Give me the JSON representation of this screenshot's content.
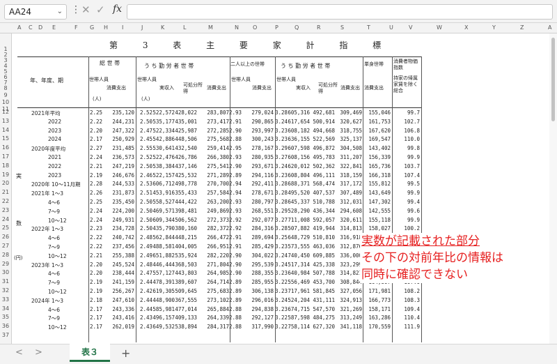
{
  "formula_bar": {
    "name_box": "AA24",
    "fx": "fx",
    "value": ""
  },
  "columns": [
    "A",
    "C",
    "D",
    "E",
    "F",
    "G",
    "H",
    "I",
    "J",
    "K",
    "L",
    "M",
    "N",
    "O",
    "P",
    "Q",
    "R",
    "S",
    "T",
    "U",
    "V",
    "W",
    "X",
    "Y",
    "Z",
    "A"
  ],
  "rows_top": [
    "1",
    "2",
    "3",
    "4",
    "5",
    "6",
    "7",
    "8",
    "9",
    "10",
    "11"
  ],
  "table": {
    "title": "第 3 表 主 要 家 計 指 標",
    "header_period": "年、年度、期",
    "group_total": "総 世 帯",
    "group_worker": "う ち 勤 労 者 世 帯",
    "group_two": "二人以上の世帯",
    "group_two_worker": "う ち 勤 労 者 世 帯",
    "group_single": "単身世帯",
    "group_cpi": "消費者物価指数",
    "h_persons": "世帯人員",
    "h_unit": "(人)",
    "h_consumption": "消費支出",
    "h_income": "実収入",
    "h_disposable": "可処分所得",
    "h_cpi_note": "持家の帰属家賃を除く総合",
    "side_jitsu": "実",
    "side_su": "数",
    "side_yen": "(円)"
  },
  "data_rows": [
    {
      "row": "12",
      "label": "2021年平均",
      "v": [
        "2.25",
        "235,120",
        "2.52",
        "522,572",
        "428,022",
        "283,807",
        "2.93",
        "279,024",
        "3.28",
        "605,316",
        "492,681",
        "309,469",
        "155,046",
        "99.7"
      ]
    },
    {
      "row": "13",
      "label": "2022",
      "v": [
        "2.22",
        "244,231",
        "2.50",
        "535,177",
        "435,001",
        "273,417",
        "2.91",
        "290,865",
        "3.24",
        "617,654",
        "500,914",
        "320,627",
        "161,753",
        "102.7"
      ]
    },
    {
      "row": "14",
      "label": "2023",
      "v": [
        "2.20",
        "247,322",
        "2.47",
        "522,334",
        "425,987",
        "272,285",
        "2.90",
        "293,997",
        "3.23",
        "608,182",
        "494,668",
        "318,755",
        "167,620",
        "106.8"
      ]
    },
    {
      "row": "15",
      "label": "2024",
      "v": [
        "2.17",
        "250,929",
        "2.45",
        "542,886",
        "448,506",
        "275,568",
        "2.88",
        "300,243",
        "3.23",
        "636,155",
        "522,569",
        "325,137",
        "169,547",
        "110.0"
      ]
    },
    {
      "row": "16",
      "label": "2020年度平均",
      "v": [
        "2.27",
        "231,485",
        "2.55",
        "530,641",
        "432,540",
        "259,414",
        "2.95",
        "278,167",
        "3.29",
        "607,598",
        "496,872",
        "304,508",
        "143,402",
        "99.8"
      ]
    },
    {
      "row": "17",
      "label": "2021",
      "v": [
        "2.24",
        "236,573",
        "2.52",
        "522,476",
        "426,786",
        "266,380",
        "2.93",
        "280,935",
        "3.27",
        "608,156",
        "495,783",
        "311,207",
        "156,339",
        "99.9"
      ]
    },
    {
      "row": "18",
      "label": "2022",
      "v": [
        "2.21",
        "247,219",
        "2.50",
        "538,384",
        "437,146",
        "275,541",
        "2.90",
        "293,671",
        "3.24",
        "620,012",
        "502,362",
        "322,841",
        "165,736",
        "103.7"
      ]
    },
    {
      "row": "19",
      "label": "2023",
      "v": [
        "2.19",
        "246,676",
        "2.46",
        "522,157",
        "425,532",
        "271,289",
        "2.89",
        "294,116",
        "3.23",
        "608,804",
        "496,111",
        "318,159",
        "166,318",
        "107.4"
      ]
    },
    {
      "row": "20",
      "label": "2020年 10～11月期",
      "v": [
        "2.28",
        "244,533",
        "2.53",
        "606,712",
        "498,778",
        "270,700",
        "2.94",
        "292,411",
        "3.28",
        "688,371",
        "568,474",
        "317,172",
        "155,812",
        "99.5"
      ]
    },
    {
      "row": "21",
      "label": "2021年 1～3",
      "v": [
        "2.26",
        "231,873",
        "2.51",
        "453,916",
        "355,433",
        "257,584",
        "2.94",
        "278,671",
        "3.28",
        "495,520",
        "407,537",
        "307,489",
        "143,649",
        "99.9"
      ]
    },
    {
      "row": "22",
      "label": "4～6",
      "v": [
        "2.25",
        "235,450",
        "2.50",
        "558,527",
        "444,422",
        "263,200",
        "2.93",
        "280,797",
        "3.28",
        "645,337",
        "510,788",
        "312,031",
        "147,302",
        "99.4"
      ]
    },
    {
      "row": "23",
      "label": "7～9",
      "v": [
        "2.24",
        "224,200",
        "2.50",
        "469,571",
        "398,481",
        "249,869",
        "2.93",
        "268,551",
        "3.29",
        "528,290",
        "436,344",
        "294,608",
        "142,555",
        "99.6"
      ]
    },
    {
      "row": "24",
      "label": "10～12",
      "v": [
        "2.24",
        "249,931",
        "2.50",
        "609,344",
        "506,562",
        "272,373",
        "2.92",
        "292,077",
        "3.27",
        "711,008",
        "592,057",
        "320,611",
        "155,118",
        "99.9"
      ]
    },
    {
      "row": "25",
      "label": "2022年 1～3",
      "v": [
        "2.23",
        "234,728",
        "2.50",
        "435,790",
        "380,160",
        "282,372",
        "2.92",
        "284,316",
        "3.28",
        "507,882",
        "419,944",
        "314,813",
        "158,027",
        "100.2"
      ]
    },
    {
      "row": "26",
      "label": "4～6",
      "v": [
        "2.22",
        "240,742",
        "2.48",
        "562,844",
        "448,215",
        "266,472",
        "2.91",
        "289,694",
        "3.25",
        "648,729",
        "510,810",
        "316,918",
        "157,120",
        "101.8"
      ]
    },
    {
      "row": "27",
      "label": "7～9",
      "v": [
        "2.22",
        "237,456",
        "2.49",
        "488,581",
        "404,005",
        "266,951",
        "2.91",
        "285,429",
        "3.23",
        "573,555",
        "463,036",
        "312,876",
        "155,806",
        "102.9"
      ]
    },
    {
      "row": "28",
      "label": "10～12",
      "v": [
        "2.21",
        "255,388",
        "2.49",
        "651,882",
        "535,924",
        "282,220",
        "2.90",
        "304,022",
        "3.24",
        "740,450",
        "609,885",
        "336,000",
        "168,094",
        "104.6"
      ]
    },
    {
      "row": "29",
      "label": "2023年 1～3",
      "v": [
        "2.20",
        "245,524",
        "2.48",
        "446,444",
        "368,503",
        "271,804",
        "2.90",
        "295,539",
        "3.24",
        "517,314",
        "425,338",
        "323,299",
        "159,241",
        "105.1"
      ]
    },
    {
      "row": "30",
      "label": "4～6",
      "v": [
        "2.20",
        "238,444",
        "2.47",
        "557,127",
        "443,803",
        "264,985",
        "2.90",
        "288,355",
        "3.23",
        "640,984",
        "507,788",
        "314,821",
        "153,027",
        "106.0"
      ]
    },
    {
      "row": "31",
      "label": "7～9",
      "v": [
        "2.19",
        "241,159",
        "2.44",
        "478,391",
        "389,607",
        "264,714",
        "2.89",
        "285,955",
        "3.22",
        "556,469",
        "453,700",
        "308,844",
        "164,807",
        "107.0"
      ]
    },
    {
      "row": "32",
      "label": "10～12",
      "v": [
        "2.19",
        "256,267",
        "2.42",
        "619,305",
        "509,645",
        "275,683",
        "2.89",
        "306,138",
        "3.23",
        "717,961",
        "581,845",
        "327,056",
        "171,981",
        "108.2"
      ]
    },
    {
      "row": "33",
      "label": "2024年 1～3",
      "v": [
        "2.18",
        "247,610",
        "2.44",
        "448,900",
        "367,555",
        "273,102",
        "2.89",
        "296,016",
        "3.24",
        "524,204",
        "431,111",
        "324,913",
        "166,773",
        "108.3"
      ]
    },
    {
      "row": "34",
      "label": "4～6",
      "v": [
        "2.17",
        "243,336",
        "2.44",
        "585,981",
        "477,014",
        "265,884",
        "2.88",
        "294,838",
        "3.23",
        "674,715",
        "547,570",
        "321,269",
        "158,171",
        "109.4"
      ]
    },
    {
      "row": "35",
      "label": "7～9",
      "v": [
        "2.17",
        "243,416",
        "2.43",
        "496,157",
        "409,133",
        "264,339",
        "2.88",
        "292,127",
        "3.22",
        "587,598",
        "484,275",
        "313,249",
        "163,286",
        "110.4"
      ]
    },
    {
      "row": "36",
      "label": "10～12",
      "v": [
        "2.17",
        "262,019",
        "2.43",
        "649,532",
        "538,894",
        "284,317",
        "2.88",
        "317,990",
        "3.22",
        "758,114",
        "627,320",
        "341,118",
        "170,559",
        "111.9"
      ]
    },
    {
      "row": "37",
      "label": "",
      "v": []
    }
  ],
  "annotation": {
    "line1": "実数が記載された部分",
    "line2": "その下の対前年比の情報は",
    "line3": "同時に確認できない",
    "color": "#e62020"
  },
  "tabs": {
    "sheet_name": "表３",
    "add_label": "+",
    "prev": "<",
    "next": ">"
  }
}
